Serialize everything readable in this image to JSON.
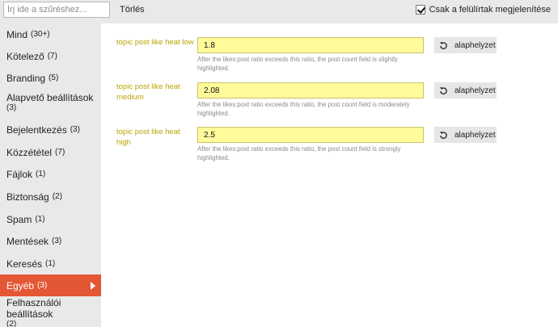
{
  "filter": {
    "placeholder": "Írj ide a szűréshez...",
    "value": "",
    "clear_label": "Törlés",
    "only_overridden_label": "Csak a felülírtak megjelenítése",
    "only_overridden_checked": true
  },
  "sidebar": {
    "items": [
      {
        "label": "Mind",
        "count": "(30+)"
      },
      {
        "label": "Kötelező",
        "count": "(7)"
      },
      {
        "label": "Branding",
        "count": "(5)"
      },
      {
        "label": "Alapvető beállítások",
        "count": "(3)"
      },
      {
        "label": "Bejelentkezés",
        "count": "(3)"
      },
      {
        "label": "Közzététel",
        "count": "(7)"
      },
      {
        "label": "Fájlok",
        "count": "(1)"
      },
      {
        "label": "Biztonság",
        "count": "(2)"
      },
      {
        "label": "Spam",
        "count": "(1)"
      },
      {
        "label": "Mentések",
        "count": "(3)"
      },
      {
        "label": "Keresés",
        "count": "(1)"
      },
      {
        "label": "Egyéb",
        "count": "(3)"
      },
      {
        "label": "Felhasználói beállítások",
        "count": "(2)"
      }
    ],
    "active_index": 11
  },
  "settings": [
    {
      "label": "topic post like heat low",
      "value": "1.8",
      "description": "After the likes:post ratio exceeds this ratio, the post count field is slightly highlighted.",
      "reset_label": "alaphelyzet"
    },
    {
      "label": "topic post like heat medium",
      "value": "2.08",
      "description": "After the likes:post ratio exceeds this ratio, the post count field is moderately highlighted.",
      "reset_label": "alaphelyzet"
    },
    {
      "label": "topic post like heat high",
      "value": "2.5",
      "description": "After the likes:post ratio exceeds this ratio, the post count field is strongly highlighted.",
      "reset_label": "alaphelyzet"
    }
  ],
  "colors": {
    "active_nav": "#e45735",
    "overridden_label": "#b9a400",
    "overridden_input_bg": "#fffa9a"
  },
  "icons": {
    "reset": "undo-icon",
    "active_nav": "caret-right-icon",
    "checkbox": "checkmark-icon"
  }
}
